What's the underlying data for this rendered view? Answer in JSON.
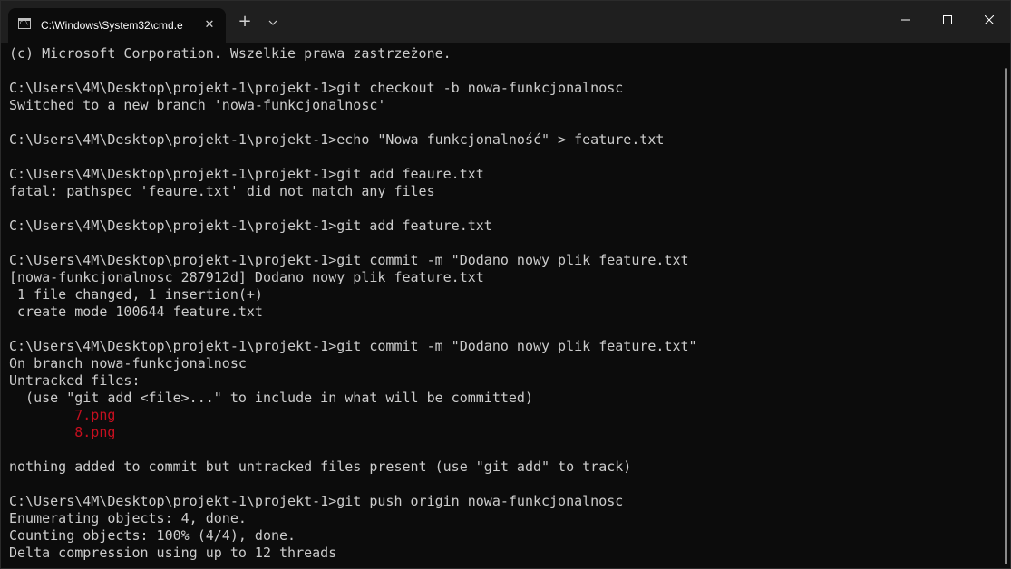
{
  "window": {
    "tab_title": "C:\\Windows\\System32\\cmd.e",
    "tab_close_glyph": "✕",
    "new_tab_glyph": "+"
  },
  "terminal": {
    "lines": [
      {
        "text": "(c) Microsoft Corporation. Wszelkie prawa zastrzeżone.",
        "color": "#cccccc"
      },
      {
        "text": "",
        "color": "#cccccc"
      },
      {
        "text": "C:\\Users\\4M\\Desktop\\projekt-1\\projekt-1>git checkout -b nowa-funkcjonalnosc",
        "color": "#cccccc"
      },
      {
        "text": "Switched to a new branch 'nowa-funkcjonalnosc'",
        "color": "#cccccc"
      },
      {
        "text": "",
        "color": "#cccccc"
      },
      {
        "text": "C:\\Users\\4M\\Desktop\\projekt-1\\projekt-1>echo \"Nowa funkcjonalność\" > feature.txt",
        "color": "#cccccc"
      },
      {
        "text": "",
        "color": "#cccccc"
      },
      {
        "text": "C:\\Users\\4M\\Desktop\\projekt-1\\projekt-1>git add feaure.txt",
        "color": "#cccccc"
      },
      {
        "text": "fatal: pathspec 'feaure.txt' did not match any files",
        "color": "#cccccc"
      },
      {
        "text": "",
        "color": "#cccccc"
      },
      {
        "text": "C:\\Users\\4M\\Desktop\\projekt-1\\projekt-1>git add feature.txt",
        "color": "#cccccc"
      },
      {
        "text": "",
        "color": "#cccccc"
      },
      {
        "text": "C:\\Users\\4M\\Desktop\\projekt-1\\projekt-1>git commit -m \"Dodano nowy plik feature.txt",
        "color": "#cccccc"
      },
      {
        "text": "[nowa-funkcjonalnosc 287912d] Dodano nowy plik feature.txt",
        "color": "#cccccc"
      },
      {
        "text": " 1 file changed, 1 insertion(+)",
        "color": "#cccccc"
      },
      {
        "text": " create mode 100644 feature.txt",
        "color": "#cccccc"
      },
      {
        "text": "",
        "color": "#cccccc"
      },
      {
        "text": "C:\\Users\\4M\\Desktop\\projekt-1\\projekt-1>git commit -m \"Dodano nowy plik feature.txt\"",
        "color": "#cccccc"
      },
      {
        "text": "On branch nowa-funkcjonalnosc",
        "color": "#cccccc"
      },
      {
        "text": "Untracked files:",
        "color": "#cccccc"
      },
      {
        "text": "  (use \"git add <file>...\" to include in what will be committed)",
        "color": "#cccccc"
      },
      {
        "text": "        7.png",
        "color": "#c50f1f"
      },
      {
        "text": "        8.png",
        "color": "#c50f1f"
      },
      {
        "text": "",
        "color": "#cccccc"
      },
      {
        "text": "nothing added to commit but untracked files present (use \"git add\" to track)",
        "color": "#cccccc"
      },
      {
        "text": "",
        "color": "#cccccc"
      },
      {
        "text": "C:\\Users\\4M\\Desktop\\projekt-1\\projekt-1>git push origin nowa-funkcjonalnosc",
        "color": "#cccccc"
      },
      {
        "text": "Enumerating objects: 4, done.",
        "color": "#cccccc"
      },
      {
        "text": "Counting objects: 100% (4/4), done.",
        "color": "#cccccc"
      },
      {
        "text": "Delta compression using up to 12 threads",
        "color": "#cccccc"
      }
    ]
  },
  "theme": {
    "background": "#0c0c0c",
    "titlebar": "#1f1f1f",
    "text": "#cccccc",
    "untracked": "#c50f1f"
  },
  "icons": {
    "tab_icon": "command-prompt-icon",
    "dropdown": "chevron-down-icon",
    "minimize": "minimize-icon",
    "maximize": "maximize-icon",
    "close": "close-icon"
  }
}
